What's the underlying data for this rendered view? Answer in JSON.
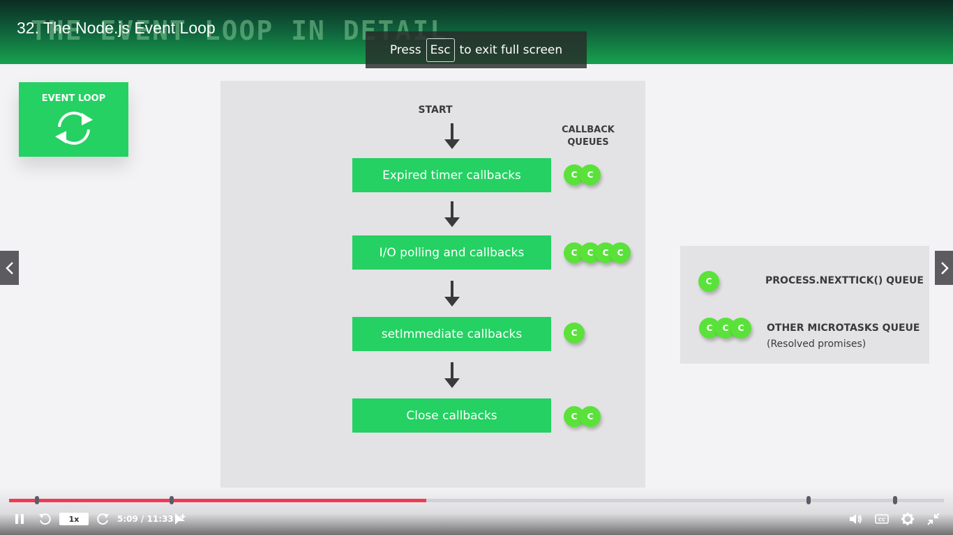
{
  "video": {
    "title": "32. The Node.js Event Loop"
  },
  "fullscreen_notice": {
    "prefix": "Press",
    "key": "Esc",
    "suffix": "to exit full screen"
  },
  "slide": {
    "header_title": "THE EVENT LOOP IN DETAIL",
    "event_loop_card_label": "EVENT LOOP",
    "start_label": "START",
    "queues_heading_line1": "CALLBACK",
    "queues_heading_line2": "QUEUES",
    "callback_marker": "C",
    "phases": [
      {
        "label": "Expired timer callbacks",
        "callback_count": 2
      },
      {
        "label": "I/O polling and callbacks",
        "callback_count": 4
      },
      {
        "label": "setImmediate callbacks",
        "callback_count": 1
      },
      {
        "label": "Close callbacks",
        "callback_count": 2
      }
    ],
    "legend": [
      {
        "title": "PROCESS.NEXTTICK() QUEUE",
        "subtitle": "",
        "callback_count": 1
      },
      {
        "title": "OTHER MICROTASKS QUEUE",
        "subtitle": "(Resolved promises)",
        "callback_count": 3
      }
    ],
    "icons": {
      "cycle": "cycle-arrows-icon",
      "flow_arrow": "arrow-down-icon"
    },
    "colors": {
      "green": "#24d162",
      "callback_green": "#5ae23b",
      "panel_gray": "#e3e2e4"
    }
  },
  "player": {
    "speed_label": "1x",
    "time_display": "5:09 / 11:33",
    "progress": 0.446,
    "bookmark_positions": [
      0.03,
      0.174,
      0.855,
      0.948
    ],
    "colors": {
      "progress": "#f13b54",
      "track": "#d2d1d5"
    },
    "icons": [
      "pause-icon",
      "rewind-icon",
      "forward-icon",
      "add-note-icon",
      "volume-icon",
      "captions-icon",
      "settings-icon",
      "exit-fullscreen-icon"
    ]
  }
}
